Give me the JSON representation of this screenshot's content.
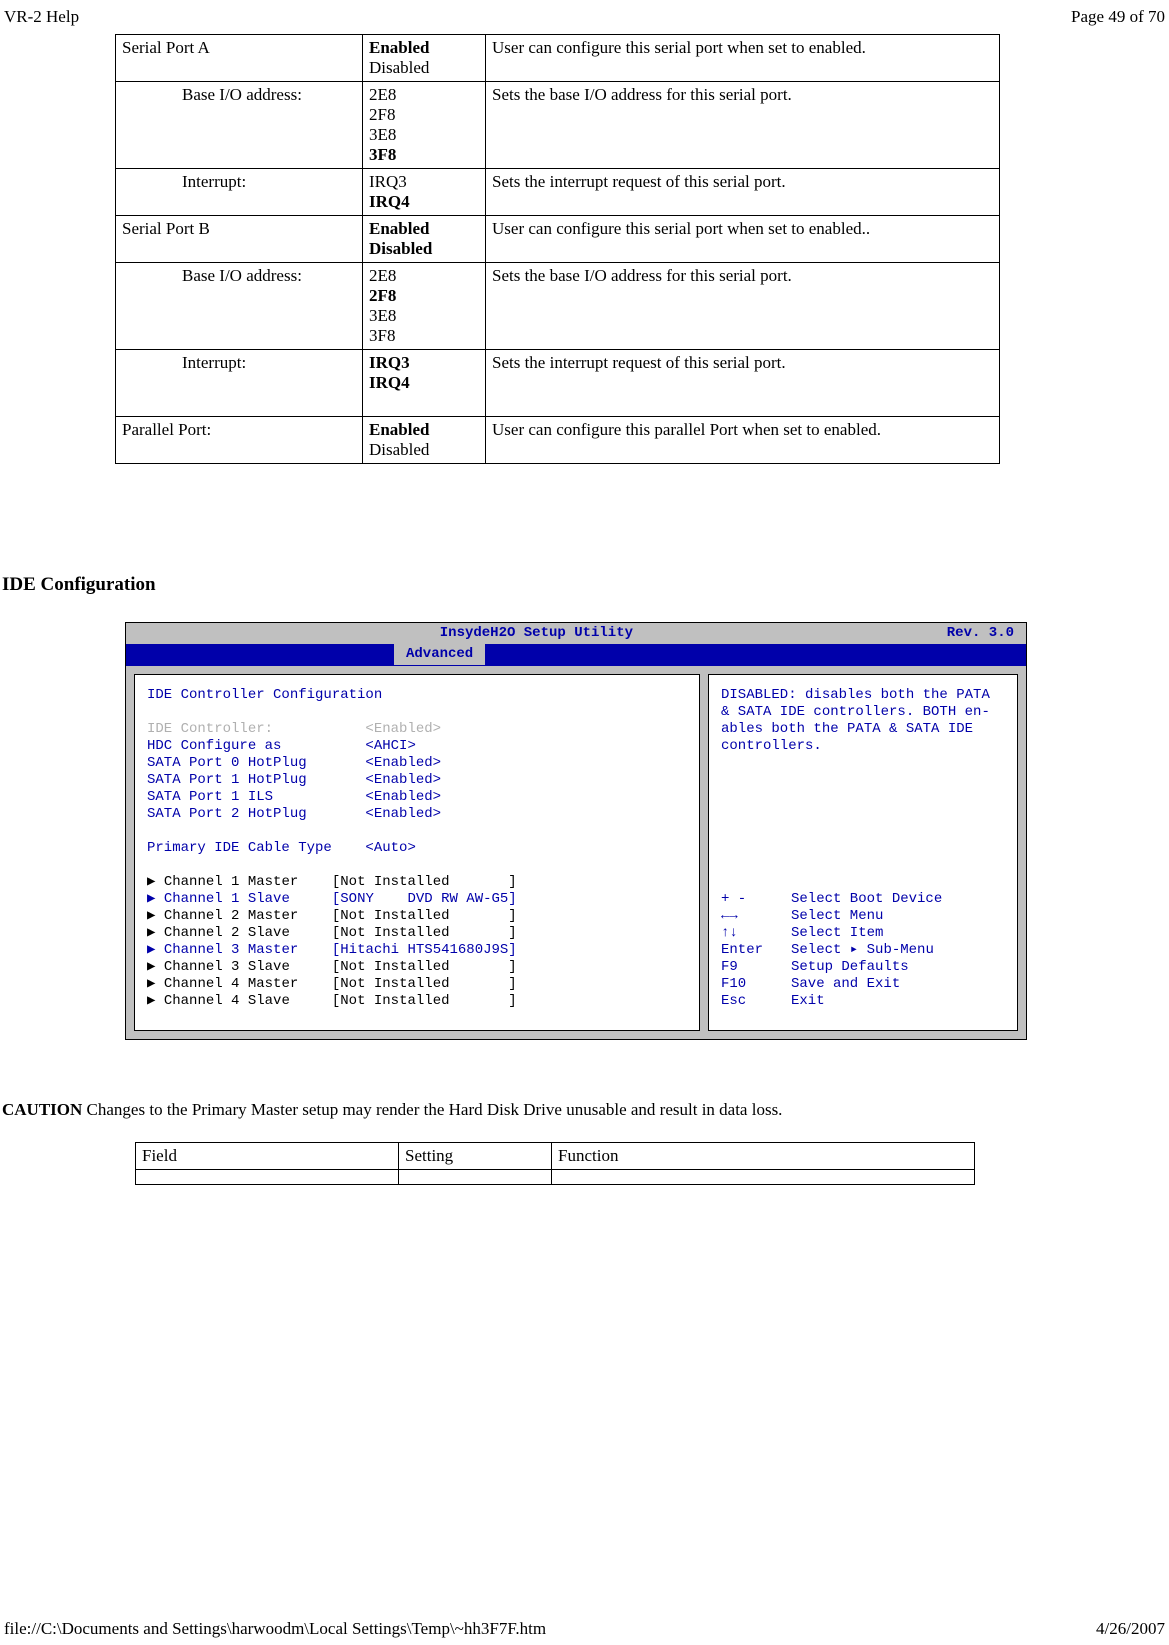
{
  "header": {
    "left": "VR-2 Help",
    "right": "Page 49 of 70"
  },
  "footer": {
    "left": "file://C:\\Documents and Settings\\harwoodm\\Local Settings\\Temp\\~hh3F7F.htm",
    "right": "4/26/2007"
  },
  "table1": {
    "rows": [
      {
        "indent": false,
        "field": "Serial Port A",
        "settings": [
          {
            "t": "Enabled",
            "b": true
          },
          {
            "t": "Disabled",
            "b": false
          }
        ],
        "func": "User can configure this serial port when set to enabled."
      },
      {
        "indent": true,
        "field": "Base I/O address:",
        "settings": [
          {
            "t": "2E8",
            "b": false
          },
          {
            "t": "2F8",
            "b": false
          },
          {
            "t": "3E8",
            "b": false
          },
          {
            "t": "3F8",
            "b": true
          }
        ],
        "func": "Sets the base I/O address for this serial port."
      },
      {
        "indent": true,
        "field": "Interrupt:",
        "settings": [
          {
            "t": "IRQ3",
            "b": false
          },
          {
            "t": "IRQ4",
            "b": true
          }
        ],
        "func": "Sets the interrupt request of this serial port."
      },
      {
        "indent": false,
        "field": "Serial Port B",
        "settings": [
          {
            "t": "Enabled",
            "b": true
          },
          {
            "t": "Disabled",
            "b": true
          }
        ],
        "func": "User can configure this serial port when set to enabled.."
      },
      {
        "indent": true,
        "field": "Base I/O address:",
        "settings": [
          {
            "t": "2E8",
            "b": false
          },
          {
            "t": "2F8",
            "b": true
          },
          {
            "t": "3E8",
            "b": false
          },
          {
            "t": "3F8",
            "b": false
          }
        ],
        "func": "Sets the base I/O address for this serial port."
      },
      {
        "indent": true,
        "field": "Interrupt:",
        "settings": [
          {
            "t": "IRQ3",
            "b": true
          },
          {
            "t": "IRQ4",
            "b": true
          }
        ],
        "func": "Sets the interrupt request of this serial port.",
        "extraBlank": true
      },
      {
        "indent": false,
        "field": "Parallel Port:",
        "settings": [
          {
            "t": "Enabled",
            "b": true
          },
          {
            "t": "Disabled",
            "b": false
          }
        ],
        "func": "User can configure this parallel Port when set to enabled."
      }
    ]
  },
  "heading": "IDE Configuration",
  "bios": {
    "titlebar": {
      "title": "InsydeH2O Setup Utility",
      "rev": "Rev. 3.0"
    },
    "menu_tab": "Advanced",
    "left": {
      "heading": "IDE Controller Configuration",
      "config_rows": [
        {
          "label": "IDE Controller:",
          "value": "<Enabled>",
          "selected": true
        },
        {
          "label": "HDC Configure as",
          "value": "<AHCI>",
          "selected": false
        },
        {
          "label": "SATA Port 0 HotPlug",
          "value": "<Enabled>",
          "selected": false
        },
        {
          "label": "SATA Port 1 HotPlug",
          "value": "<Enabled>",
          "selected": false
        },
        {
          "label": "SATA Port 1 ILS",
          "value": "<Enabled>",
          "selected": false
        },
        {
          "label": "SATA Port 2 HotPlug",
          "value": "<Enabled>",
          "selected": false
        }
      ],
      "cable_row": {
        "label": "Primary IDE Cable Type",
        "value": "<Auto>"
      },
      "channel_rows": [
        {
          "tri": "black",
          "label": "Channel 1 Master",
          "value": "[Not Installed       ]"
        },
        {
          "tri": "blue",
          "label": "Channel 1 Slave",
          "value": "[SONY    DVD RW AW-G5]"
        },
        {
          "tri": "black",
          "label": "Channel 2 Master",
          "value": "[Not Installed       ]"
        },
        {
          "tri": "black",
          "label": "Channel 2 Slave",
          "value": "[Not Installed       ]"
        },
        {
          "tri": "blue",
          "label": "Channel 3 Master",
          "value": "[Hitachi HTS541680J9S]"
        },
        {
          "tri": "black",
          "label": "Channel 3 Slave",
          "value": "[Not Installed       ]"
        },
        {
          "tri": "black",
          "label": "Channel 4 Master",
          "value": "[Not Installed       ]"
        },
        {
          "tri": "black",
          "label": "Channel 4 Slave",
          "value": "[Not Installed       ]"
        }
      ]
    },
    "right": {
      "help_text": "DISABLED: disables both the PATA & SATA IDE controllers.  BOTH en-ables both the PATA & SATA IDE controllers.",
      "keys": [
        {
          "k": "+ -",
          "d": "Select Boot Device"
        },
        {
          "k": "←→",
          "d": "Select Menu"
        },
        {
          "k": "↑↓",
          "d": "Select Item"
        },
        {
          "k": "Enter",
          "d": "Select ▸ Sub-Menu"
        },
        {
          "k": "F9",
          "d": "Setup Defaults"
        },
        {
          "k": "F10",
          "d": "Save and Exit"
        },
        {
          "k": "Esc",
          "d": "Exit"
        }
      ]
    }
  },
  "caution": {
    "label": "CAUTION",
    "text": "  Changes to the Primary Master setup may render the Hard Disk Drive unusable and result in data loss."
  },
  "table2": {
    "headers": {
      "field": "Field",
      "setting": "Setting",
      "func": "Function"
    }
  }
}
